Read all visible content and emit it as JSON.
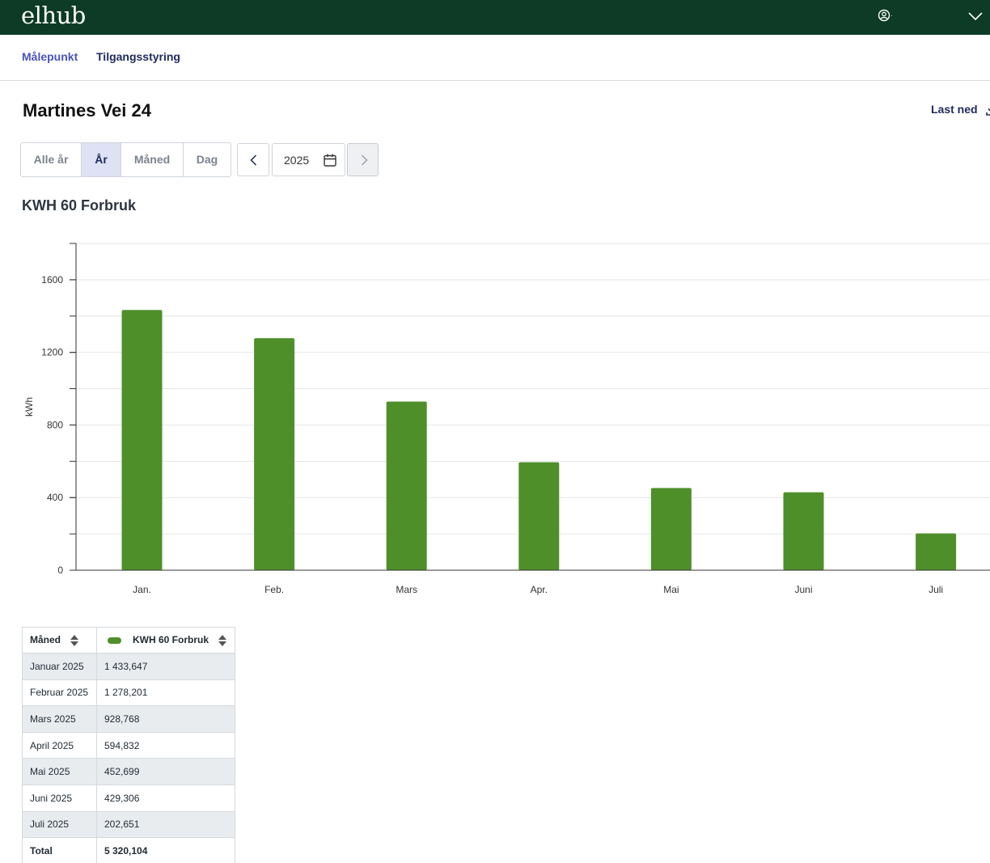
{
  "app": {
    "logo": "elhub",
    "user_label": "·"
  },
  "nav": {
    "items": [
      {
        "label": "Målepunkt"
      },
      {
        "label": "Tilgangsstyring"
      }
    ]
  },
  "page": {
    "title": "Martines Vei 24",
    "download_label": "Last ned"
  },
  "period_tabs": [
    {
      "label": "Alle år"
    },
    {
      "label": "År"
    },
    {
      "label": "Måned"
    },
    {
      "label": "Dag"
    }
  ],
  "active_tab": "År",
  "year_selector": {
    "value": "2025"
  },
  "chart_section": {
    "title": "KWH 60 Forbruk"
  },
  "colors": {
    "bar": "#4f8f2a",
    "header_bg": "#0d3b25",
    "active_nav": "#4b53bc"
  },
  "chart_data": {
    "type": "bar",
    "categories": [
      "Jan.",
      "Feb.",
      "Mars",
      "Apr.",
      "Mai",
      "Juni",
      "Juli"
    ],
    "values": [
      1433.647,
      1278.201,
      928.768,
      594.832,
      452.699,
      429.306,
      202.651
    ],
    "ylabel": "kWh",
    "ylim": [
      0,
      1800
    ],
    "yticks": [
      0,
      400,
      800,
      1200,
      1600
    ],
    "grid": true
  },
  "table": {
    "headers": {
      "month": "Måned",
      "value": "KWH 60 Forbruk"
    },
    "rows": [
      {
        "month": "Januar 2025",
        "value": "1 433,647"
      },
      {
        "month": "Februar 2025",
        "value": "1 278,201"
      },
      {
        "month": "Mars 2025",
        "value": "928,768"
      },
      {
        "month": "April 2025",
        "value": "594,832"
      },
      {
        "month": "Mai 2025",
        "value": "452,699"
      },
      {
        "month": "Juni 2025",
        "value": "429,306"
      },
      {
        "month": "Juli 2025",
        "value": "202,651"
      }
    ],
    "total": {
      "label": "Total",
      "value": "5 320,104"
    }
  }
}
